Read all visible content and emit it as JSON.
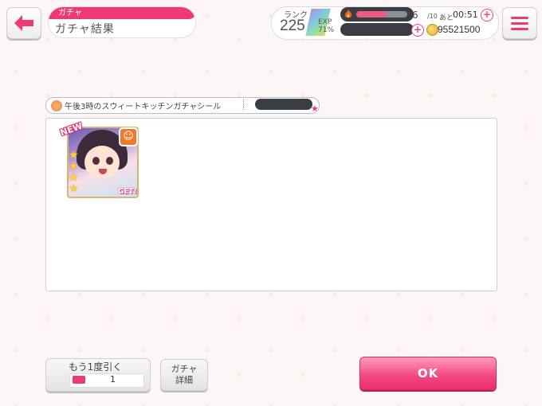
{
  "header": {
    "section_label": "ガチャ",
    "title": "ガチャ結果"
  },
  "status": {
    "rank_label": "ランク",
    "rank_value": "225",
    "exp_label": "EXP",
    "exp_percent": "71%",
    "ap_current": "6",
    "ap_max": "/10",
    "ap_ato": "あと",
    "ap_timer": "00:51",
    "ap_fill_fraction": 0.6,
    "coins": "95521500"
  },
  "gacha": {
    "name": "午後3時のスウィートキッチンガチャシール"
  },
  "card": {
    "new_label": "NEW",
    "get_label": "GET!",
    "stars": 4,
    "attribute_icon": "happy-icon"
  },
  "buttons": {
    "again_label": "もう1度引く",
    "ticket_count": "1",
    "detail_line1": "ガチャ",
    "detail_line2": "詳細",
    "ok_label": "OK"
  },
  "colors": {
    "accent_pink": "#ee3a71",
    "ok_button": "#f3457e"
  }
}
